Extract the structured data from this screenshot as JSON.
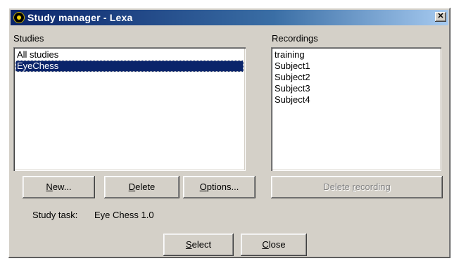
{
  "window": {
    "title": "Study manager - Lexa"
  },
  "studies": {
    "label": "Studies",
    "items": [
      {
        "label": "All studies",
        "selected": false
      },
      {
        "label": "EyeChess",
        "selected": true
      }
    ]
  },
  "recordings": {
    "label": "Recordings",
    "items": [
      "training",
      "Subject1",
      "Subject2",
      "Subject3",
      "Subject4"
    ]
  },
  "buttons": {
    "new": {
      "mnemonic": "N",
      "rest": "ew..."
    },
    "delete": {
      "mnemonic": "D",
      "rest": "elete"
    },
    "options": {
      "mnemonic": "O",
      "rest": "ptions..."
    },
    "delete_recording": {
      "pre": "Delete ",
      "mnemonic": "r",
      "rest": "ecording"
    },
    "select": {
      "mnemonic": "S",
      "rest": "elect"
    },
    "close": {
      "mnemonic": "C",
      "rest": "lose"
    }
  },
  "study_task": {
    "label": "Study task:",
    "value": "Eye Chess 1.0"
  },
  "icons": {
    "app": "app-eye-icon",
    "close": "close-icon"
  }
}
